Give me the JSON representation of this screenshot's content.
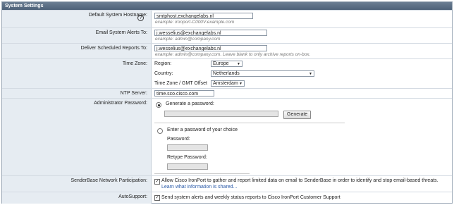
{
  "section_title": "System Settings",
  "hostname": {
    "label": "Default System Hostname:",
    "help": "?",
    "value": "smtphost.exchangelabs.nl",
    "example": "example: ironport-C000V.example.com"
  },
  "alerts": {
    "label": "Email System Alerts To:",
    "value": "j.wesselius@exchangelabs.nl",
    "example": "example: admin@company.com"
  },
  "reports": {
    "label": "Deliver Scheduled Reports To:",
    "value": "j.wesselius@exchangelabs.nl",
    "example": "example: admin@company.com. Leave blank to only archive reports on-box."
  },
  "timezone": {
    "label": "Time Zone:",
    "region_label": "Region:",
    "region": "Europe",
    "country_label": "Country:",
    "country": "Netherlands",
    "tz_label": "Time Zone / GMT Offset",
    "tz": "Amsterdam"
  },
  "ntp": {
    "label": "NTP Server:",
    "value": "time.sco.cisco.com"
  },
  "admin_pw": {
    "label": "Administrator Password:",
    "generate_label": "Generate a password:",
    "generate_button": "Generate",
    "choice_label": "Enter a password of your choice",
    "password_label": "Password:",
    "retype_label": "Retype Password:",
    "selected": "generate"
  },
  "senderbase": {
    "label": "SenderBase Network Participation:",
    "checked": true,
    "text": "Allow Cisco IronPort to gather and report limited data on email to SenderBase in order to identify and stop email-based threats.",
    "link": "Learn what information is shared..."
  },
  "autosupport": {
    "label": "AutoSupport:",
    "checked": true,
    "text": "Send system alerts and weekly status reports to Cisco IronPort Customer Support"
  }
}
